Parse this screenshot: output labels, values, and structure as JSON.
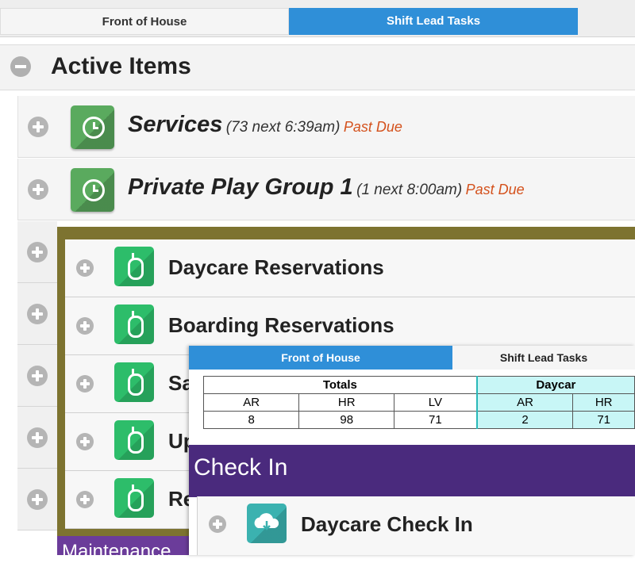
{
  "base": {
    "tabs": [
      "Front of House",
      "Shift Lead Tasks"
    ],
    "section_title": "Active Items",
    "rows": [
      {
        "title": "Services",
        "detail": "(73 next 6:39am)",
        "status": "Past Due"
      },
      {
        "title": "Private Play Group 1",
        "detail": "(1 next 8:00am)",
        "status": "Past Due"
      }
    ]
  },
  "middle": {
    "items": [
      {
        "label": "Daycare Reservations"
      },
      {
        "label": "Boarding Reservations"
      },
      {
        "label": "Sa"
      },
      {
        "label": "Up"
      },
      {
        "label": "Re"
      }
    ],
    "footer": "Maintenance"
  },
  "top": {
    "tabs": [
      "Front of House",
      "Shift Lead Tasks"
    ],
    "stats": {
      "groups": [
        "Totals",
        "Daycar"
      ],
      "columns": [
        "AR",
        "HR",
        "LV",
        "AR",
        "HR"
      ],
      "values": [
        "8",
        "98",
        "71",
        "2",
        "71"
      ]
    },
    "section_title": "Check In",
    "item": "Daycare Check In"
  },
  "colors": {
    "tab_active": "#2f8fd8",
    "past_due": "#d4511c",
    "clock_tile": "#5aaa5e",
    "mouse_tile": "#2dbd6a",
    "cloud_tile": "#3bb2b0",
    "olive_panel": "#7d7330",
    "purple_header": "#4a2a7d"
  }
}
